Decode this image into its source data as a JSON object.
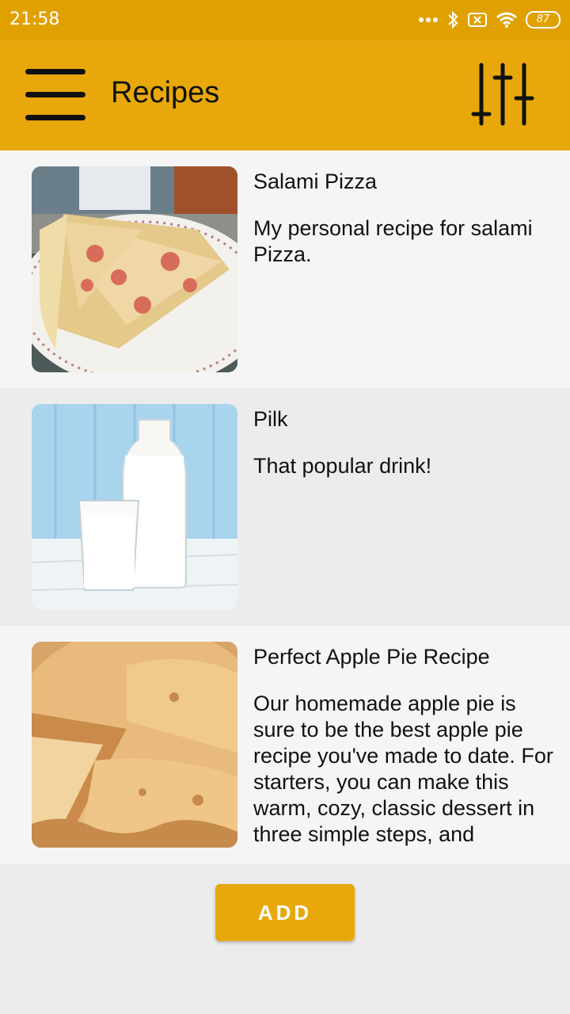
{
  "status_bar": {
    "time": "21:58",
    "battery": "87",
    "icons": [
      "more-dots-icon",
      "bluetooth-icon",
      "sim-off-icon",
      "wifi-icon",
      "battery-icon"
    ]
  },
  "app_bar": {
    "title": "Recipes",
    "menu_icon": "hamburger-menu-icon",
    "filter_icon": "sliders-filter-icon",
    "background": "#e8a80c"
  },
  "recipes": [
    {
      "title": "Salami Pizza",
      "description": "My personal recipe for salami Pizza.",
      "image": "salami-pizza-photo"
    },
    {
      "title": "Pilk",
      "description": "That popular drink!",
      "image": "milk-bottle-photo"
    },
    {
      "title": "Perfect Apple Pie Recipe",
      "description": "Our homemade apple pie is sure to be the best apple pie recipe you've made to date. For starters, you can make this warm, cozy, classic dessert in three simple steps, and",
      "image": "apple-pie-photo"
    }
  ],
  "actions": {
    "add_label": "ADD"
  },
  "colors": {
    "accent": "#e8a80c",
    "status_bar": "#e0a100"
  }
}
